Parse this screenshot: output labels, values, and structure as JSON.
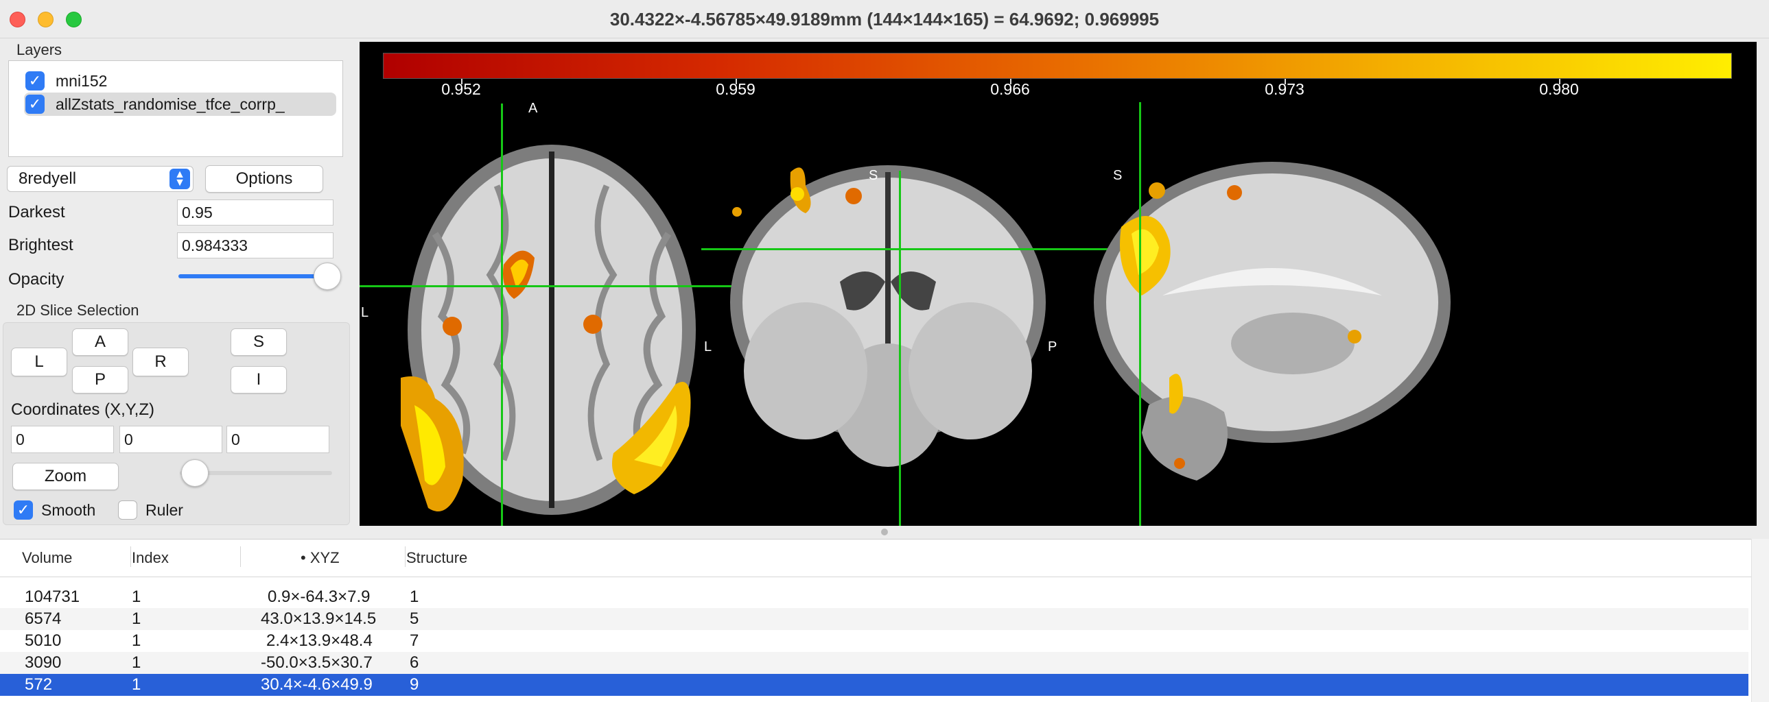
{
  "window": {
    "title": "30.4322×-4.56785×49.9189mm (144×144×165) =  64.9692;  0.969995"
  },
  "layers": {
    "label": "Layers",
    "items": [
      {
        "name": "mni152",
        "checked": true
      },
      {
        "name": "allZstats_randomise_tfce_corrp_",
        "checked": true
      }
    ]
  },
  "colormap": {
    "selected": "8redyell",
    "options_button": "Options"
  },
  "display": {
    "darkest_label": "Darkest",
    "darkest_value": "0.95",
    "brightest_label": "Brightest",
    "brightest_value": "0.984333",
    "opacity_label": "Opacity",
    "opacity": 0.98
  },
  "slice_selection": {
    "label": "2D Slice Selection",
    "buttons": {
      "L": "L",
      "A": "A",
      "R": "R",
      "P": "P",
      "S": "S",
      "I": "I"
    },
    "coords_label": "Coordinates (X,Y,Z)",
    "x": "0",
    "y": "0",
    "z": "0",
    "zoom_button": "Zoom",
    "zoom_level": 0.0,
    "smooth_label": "Smooth",
    "smooth_checked": true,
    "ruler_label": "Ruler",
    "ruler_checked": false
  },
  "viewer": {
    "colorbar_ticks": [
      "0.952",
      "0.959",
      "0.966",
      "0.973",
      "0.980"
    ],
    "orientation": {
      "axial_top": "A",
      "axial_left": "L",
      "coronal_top": "S",
      "coronal_left": "L",
      "sagittal_top": "S",
      "sagittal_left": "P"
    },
    "crosshair_color": "#16c716"
  },
  "table": {
    "headers": [
      "Volume",
      "Index",
      "• XYZ",
      "Structure"
    ],
    "rows": [
      {
        "volume": "104731",
        "index": "1",
        "xyz": "0.9×-64.3×7.9",
        "structure": "1"
      },
      {
        "volume": "6574",
        "index": "1",
        "xyz": "43.0×13.9×14.5",
        "structure": "5"
      },
      {
        "volume": "5010",
        "index": "1",
        "xyz": "2.4×13.9×48.4",
        "structure": "7"
      },
      {
        "volume": "3090",
        "index": "1",
        "xyz": "-50.0×3.5×30.7",
        "structure": "6"
      },
      {
        "volume": "572",
        "index": "1",
        "xyz": "30.4×-4.6×49.9",
        "structure": "9"
      }
    ],
    "selected_row": 4,
    "selection_color": "#2860d8"
  }
}
